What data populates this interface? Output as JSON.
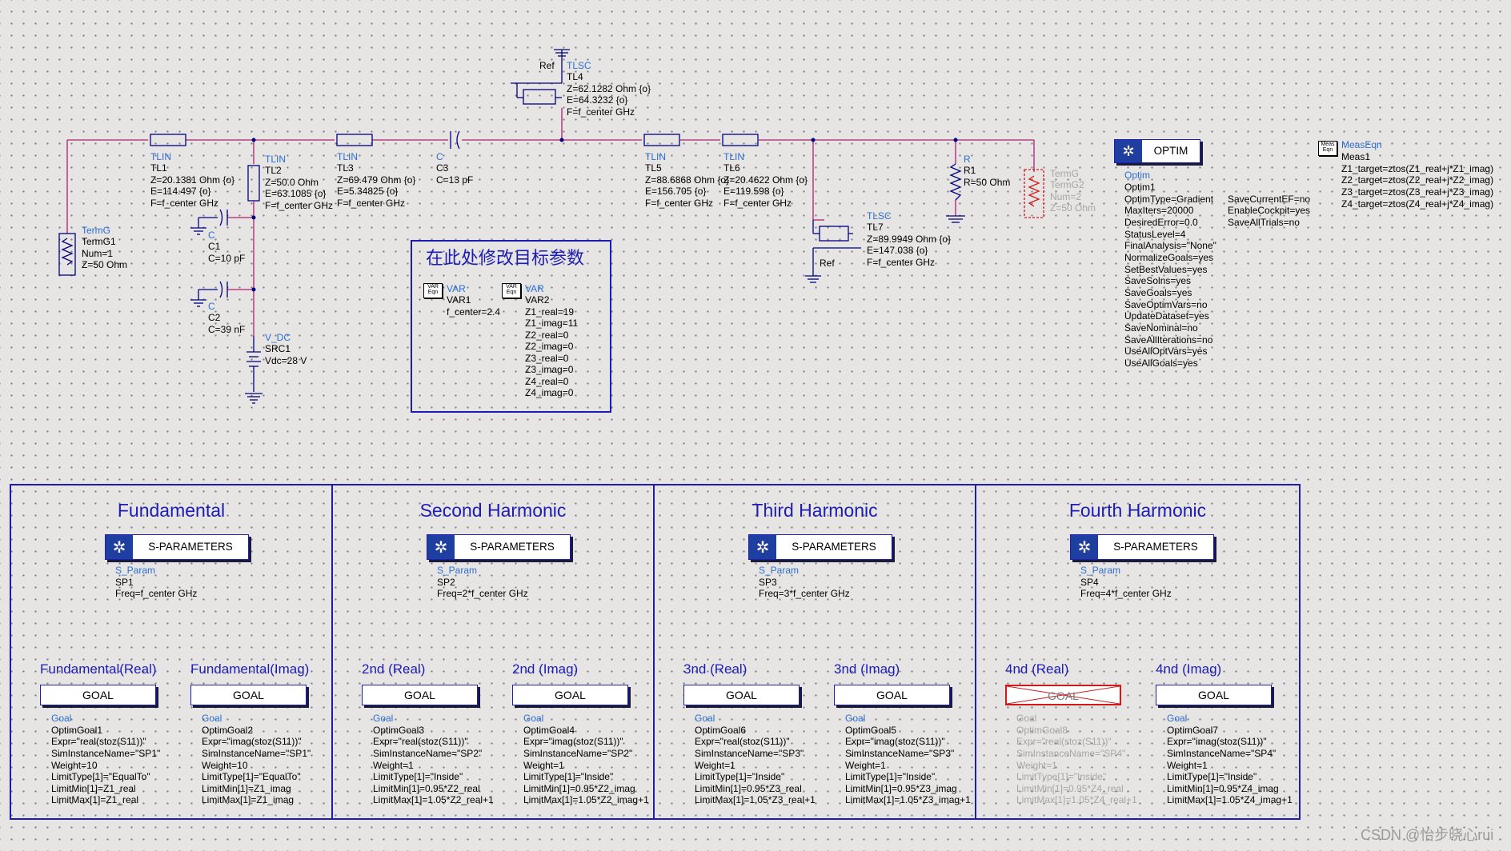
{
  "colors": {
    "wire": "#b0206f",
    "component": "#000080",
    "panel_border": "#1d1db4",
    "label_blue": "#2a6fd1",
    "disabled": "#d01a1a"
  },
  "components": {
    "tlsc4": {
      "ref": "Ref",
      "type": "TLSC",
      "name": "TL4",
      "p1": "Z=62.1282 Ohm {o}",
      "p2": "E=64.3232 {o}",
      "p3": "F=f_center GHz"
    },
    "tlin1": {
      "type": "TLIN",
      "name": "TL1",
      "p1": "Z=20.1381 Ohm {o}",
      "p2": "E=114.497 {o}",
      "p3": "F=f_center GHz"
    },
    "tlin2": {
      "type": "TLIN",
      "name": "TL2",
      "p1": "Z=50.0 Ohm",
      "p2": "E=63.1085 {o}",
      "p3": "F=f_center GHz"
    },
    "tlin3": {
      "type": "TLIN",
      "name": "TL3",
      "p1": "Z=69.479 Ohm {o}",
      "p2": "E=5.34825 {o}",
      "p3": "F=f_center GHz"
    },
    "c3": {
      "type": "C",
      "name": "C3",
      "p1": "C=13 pF"
    },
    "tlin5": {
      "type": "TLIN",
      "name": "TL5",
      "p1": "Z=88.6868 Ohm {o}",
      "p2": "E=156.705 {o}",
      "p3": "F=f_center GHz"
    },
    "tlin6": {
      "type": "TLIN",
      "name": "TL6",
      "p1": "Z=20.4622 Ohm {o}",
      "p2": "E=119.598 {o}",
      "p3": "F=f_center GHz"
    },
    "r1": {
      "type": "R",
      "name": "R1",
      "p1": "R=50 Ohm"
    },
    "termg2": {
      "type": "TermG",
      "name": "TermG2",
      "p1": "Num=2",
      "p2": "Z=50 Ohm"
    },
    "termg1": {
      "type": "TermG",
      "name": "TermG1",
      "p1": "Num=1",
      "p2": "Z=50 Ohm"
    },
    "c1": {
      "type": "C",
      "name": "C1",
      "p1": "C=10 pF"
    },
    "c2": {
      "type": "C",
      "name": "C2",
      "p1": "C=39 nF"
    },
    "vdc": {
      "type": "V_DC",
      "name": "SRC1",
      "p1": "Vdc=28 V"
    },
    "tlsc7": {
      "type": "TLSC",
      "name": "TL7",
      "p1": "Z=89.9949 Ohm {o}",
      "p2": "E=147.038 {o}",
      "p3": "F=f_center GHz",
      "ref": "Ref"
    }
  },
  "varbox": {
    "title": "在此处修改目标参数",
    "var1": {
      "icon": "VAR Eqn",
      "type": "VAR",
      "name": "VAR1",
      "lines": [
        "f_center=2.4"
      ]
    },
    "var2": {
      "icon": "VAR Eqn",
      "type": "VAR",
      "name": "VAR2",
      "lines": [
        "Z1_real=19",
        "Z1_imag=11",
        "Z2_real=0",
        "Z2_imag=0",
        "Z3_real=0",
        "Z3_imag=0",
        "Z4_real=0",
        "Z4_imag=0"
      ]
    }
  },
  "optim": {
    "button": "OPTIM",
    "type": "Optim",
    "name": "Optim1",
    "col1": [
      "OptimType=Gradient",
      "MaxIters=20000",
      "DesiredError=0.0",
      "StatusLevel=4",
      "FinalAnalysis=\"None\"",
      "NormalizeGoals=yes",
      "SetBestValues=yes",
      "SaveSolns=yes",
      "SaveGoals=yes",
      "SaveOptimVars=no",
      "UpdateDataset=yes",
      "SaveNominal=no",
      "SaveAllIterations=no",
      "UseAllOptVars=yes",
      "UseAllGoals=yes"
    ],
    "col2": [
      "SaveCurrentEF=no",
      "EnableCockpit=yes",
      "SaveAllTrials=no"
    ]
  },
  "measeqn": {
    "icon": "Meas Eqn",
    "type": "MeasEqn",
    "name": "Meas1",
    "lines": [
      "Z1_target=ztos(Z1_real+j*Z1_imag)",
      "Z2_target=ztos(Z2_real+j*Z2_imag)",
      "Z3_target=ztos(Z3_real+j*Z3_imag)",
      "Z4_target=ztos(Z4_real+j*Z4_imag)"
    ]
  },
  "panels": [
    {
      "title": "Fundamental",
      "sp_button": "S-PARAMETERS",
      "sp_type": "S_Param",
      "sp_name": "SP1",
      "sp_freq": "Freq=f_center GHz",
      "goals": [
        {
          "title": "Fundamental(Real)",
          "button": "GOAL",
          "type": "Goal",
          "name": "OptimGoal1",
          "lines": [
            "Expr=\"real(stoz(S11))\"",
            "SimInstanceName=\"SP1\"",
            "Weight=10",
            "LimitType[1]=\"EqualTo\"",
            "LimitMin[1]=Z1_real",
            "LimitMax[1]=Z1_real"
          ]
        },
        {
          "title": "Fundamental(Imag)",
          "button": "GOAL",
          "type": "Goal",
          "name": "OptimGoal2",
          "lines": [
            "Expr=\"imag(stoz(S11))\"",
            "SimInstanceName=\"SP1\"",
            "Weight=10",
            "LimitType[1]=\"EqualTo\"",
            "LimitMin[1]=Z1_imag",
            "LimitMax[1]=Z1_imag"
          ]
        }
      ]
    },
    {
      "title": "Second Harmonic",
      "sp_button": "S-PARAMETERS",
      "sp_type": "S_Param",
      "sp_name": "SP2",
      "sp_freq": "Freq=2*f_center GHz",
      "goals": [
        {
          "title": "2nd (Real)",
          "button": "GOAL",
          "type": "Goal",
          "name": "OptimGoal3",
          "lines": [
            "Expr=\"real(stoz(S11))\"",
            "SimInstanceName=\"SP2\"",
            "Weight=1",
            "LimitType[1]=\"Inside\"",
            "LimitMin[1]=0.95*Z2_real",
            "LimitMax[1]=1.05*Z2_real+1"
          ]
        },
        {
          "title": "2nd (Imag)",
          "button": "GOAL",
          "type": "Goal",
          "name": "OptimGoal4",
          "lines": [
            "Expr=\"imag(stoz(S11))\"",
            "SimInstanceName=\"SP2\"",
            "Weight=1",
            "LimitType[1]=\"Inside\"",
            "LimitMin[1]=0.95*Z2_imag",
            "LimitMax[1]=1.05*Z2_imag+1"
          ]
        }
      ]
    },
    {
      "title": "Third Harmonic",
      "sp_button": "S-PARAMETERS",
      "sp_type": "S_Param",
      "sp_name": "SP3",
      "sp_freq": "Freq=3*f_center GHz",
      "goals": [
        {
          "title": "3nd (Real)",
          "button": "GOAL",
          "type": "Goal",
          "name": "OptimGoal6",
          "lines": [
            "Expr=\"real(stoz(S11))\"",
            "SimInstanceName=\"SP3\"",
            "Weight=1",
            "LimitType[1]=\"Inside\"",
            "LimitMin[1]=0.95*Z3_real",
            "LimitMax[1]=1.05*Z3_real+1"
          ]
        },
        {
          "title": "3nd (Imag)",
          "button": "GOAL",
          "type": "Goal",
          "name": "OptimGoal5",
          "lines": [
            "Expr=\"imag(stoz(S11))\"",
            "SimInstanceName=\"SP3\"",
            "Weight=1",
            "LimitType[1]=\"Inside\"",
            "LimitMin[1]=0.95*Z3_imag",
            "LimitMax[1]=1.05*Z3_imag+1"
          ]
        }
      ]
    },
    {
      "title": "Fourth Harmonic",
      "sp_button": "S-PARAMETERS",
      "sp_type": "S_Param",
      "sp_name": "SP4",
      "sp_freq": "Freq=4*f_center GHz",
      "goals": [
        {
          "title": "4nd (Real)",
          "button": "GOAL",
          "type": "Goal",
          "name": "OptimGoal8",
          "disabled": true,
          "lines": [
            "Expr=\"real(stoz(S11))\"",
            "SimInstanceName=\"SP4\"",
            "Weight=1",
            "LimitType[1]=\"Inside\"",
            "LimitMin[1]=0.95*Z4_real",
            "LimitMax[1]=1.05*Z4_real+1"
          ]
        },
        {
          "title": "4nd (Imag)",
          "button": "GOAL",
          "type": "Goal",
          "name": "OptimGoal7",
          "lines": [
            "Expr=\"imag(stoz(S11))\"",
            "SimInstanceName=\"SP4\"",
            "Weight=1",
            "LimitType[1]=\"Inside\"",
            "LimitMin[1]=0.95*Z4_imag",
            "LimitMax[1]=1.05*Z4_imag+1"
          ]
        }
      ]
    }
  ],
  "watermark": "CSDN @怡步晓心rui"
}
